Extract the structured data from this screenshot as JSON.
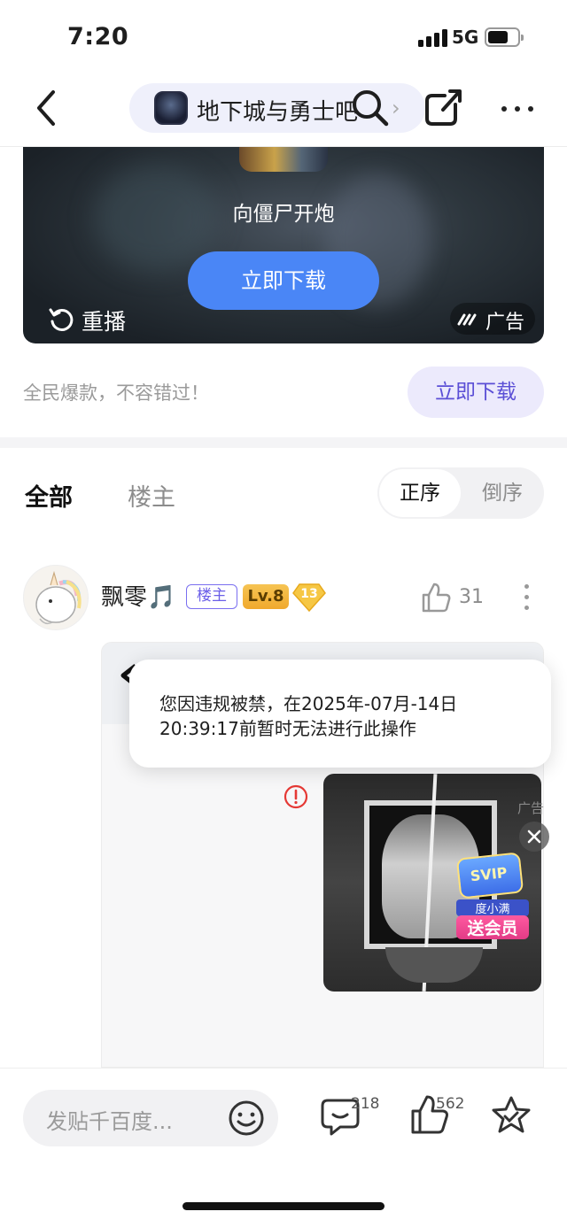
{
  "status_bar": {
    "time": "7:20",
    "network": "5G"
  },
  "nav": {
    "forum_name": "地下城与勇士吧",
    "chevron": "›"
  },
  "ad": {
    "title": "向僵尸开炮",
    "download_label": "立即下载",
    "replay_label": "重播",
    "ad_tag": "广告",
    "slogan": "全民爆款，不容错过！",
    "download_label_2": "立即下载"
  },
  "filter": {
    "tab_all": "全部",
    "tab_op": "楼主",
    "sort_asc": "正序",
    "sort_desc": "倒序"
  },
  "post": {
    "username": "飘零🎵",
    "badge_op": "楼主",
    "level": "Lv.8",
    "gem_level": "13",
    "like_count": "31"
  },
  "ban_toast": {
    "text": "您因违规被禁，在2025年-07月-14日20:39:17前暂时无法进行此操作"
  },
  "mini_ad": {
    "label": "广告",
    "svip": "SVIP",
    "brand": "度小满",
    "gift": "送会员"
  },
  "bottom_bar": {
    "input_placeholder": "发贴千百度...",
    "comment_count": "218",
    "like_count": "562"
  },
  "colors": {
    "accent": "#4a86f6",
    "op_badge": "#6b5fe8",
    "level_badge": "#f0a92d",
    "error": "#e53935"
  },
  "icons": [
    "back-icon",
    "search-icon",
    "share-icon",
    "more-icon",
    "replay-icon",
    "ad-logo-icon",
    "like-icon",
    "emoji-icon",
    "comment-icon",
    "star-icon",
    "close-icon",
    "error-icon"
  ]
}
